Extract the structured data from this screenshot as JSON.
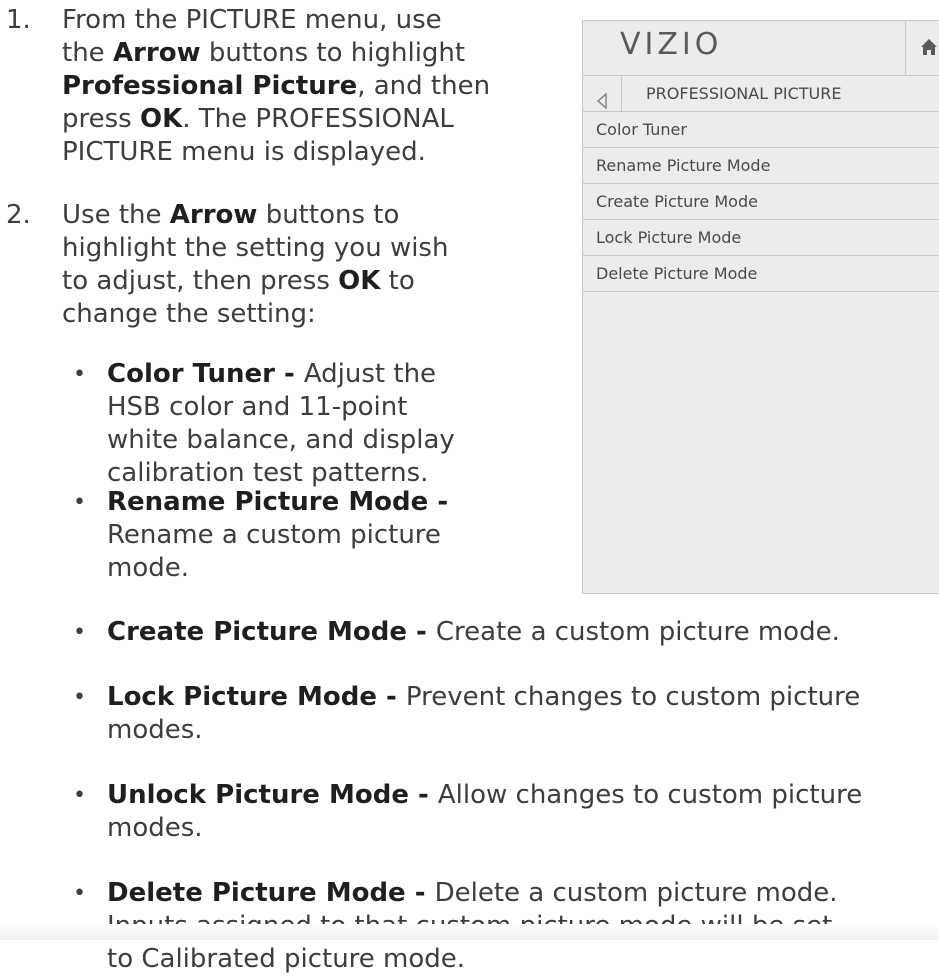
{
  "steps": [
    {
      "number": "1.",
      "lines": [
        [
          "From the PICTURE menu, use"
        ],
        [
          "the ",
          {
            "b": "Arrow"
          },
          " buttons to highlight"
        ],
        [
          {
            "b": "Professional Picture"
          },
          ", and then"
        ],
        [
          "press ",
          {
            "b": "OK"
          },
          ". The PROFESSIONAL"
        ],
        [
          "PICTURE menu is displayed."
        ]
      ]
    },
    {
      "number": "2.",
      "lines": [
        [
          "Use the ",
          {
            "b": "Arrow"
          },
          " buttons to"
        ],
        [
          "highlight the setting you wish"
        ],
        [
          "to adjust, then press ",
          {
            "b": "OK"
          },
          " to"
        ],
        [
          "change the setting:"
        ]
      ]
    }
  ],
  "bullets": [
    {
      "dot": "•",
      "lines": [
        [
          {
            "b": "Color Tuner - "
          },
          "Adjust the"
        ],
        [
          "HSB color and 11-point"
        ],
        [
          "white balance, and display"
        ],
        [
          "calibration test patterns."
        ]
      ]
    },
    {
      "dot": "•",
      "lines": [
        [
          {
            "b": "Rename Picture Mode -"
          }
        ],
        [
          "Rename a custom picture"
        ],
        [
          "mode."
        ]
      ]
    },
    {
      "dot": "•",
      "lines": [
        [
          {
            "b": "Create Picture Mode - "
          },
          "Create a custom picture mode."
        ]
      ]
    },
    {
      "dot": "•",
      "lines": [
        [
          {
            "b": "Lock Picture Mode - "
          },
          "Prevent changes to custom picture"
        ],
        [
          "modes."
        ]
      ]
    },
    {
      "dot": "•",
      "lines": [
        [
          {
            "b": "Unlock Picture Mode - "
          },
          "Allow changes to custom picture"
        ],
        [
          "modes."
        ]
      ]
    },
    {
      "dot": "•",
      "lines": [
        [
          {
            "b": "Delete Picture Mode - "
          },
          "Delete a custom picture mode."
        ],
        [
          "Inputs assigned to that custom picture mode will be set"
        ],
        [
          "to Calibrated picture mode."
        ]
      ]
    }
  ],
  "tv_menu": {
    "logo": "VIZIO",
    "home_icon": "home-icon",
    "back_icon": "back-arrow-icon",
    "title": "PROFESSIONAL PICTURE",
    "items": [
      "Color Tuner",
      "Rename Picture Mode",
      "Create Picture Mode",
      "Lock Picture Mode",
      "Delete Picture Mode"
    ],
    "colors": {
      "panel_bg": "#ececec",
      "border": "#c7c7c7",
      "text": "#4a4a4a"
    }
  }
}
